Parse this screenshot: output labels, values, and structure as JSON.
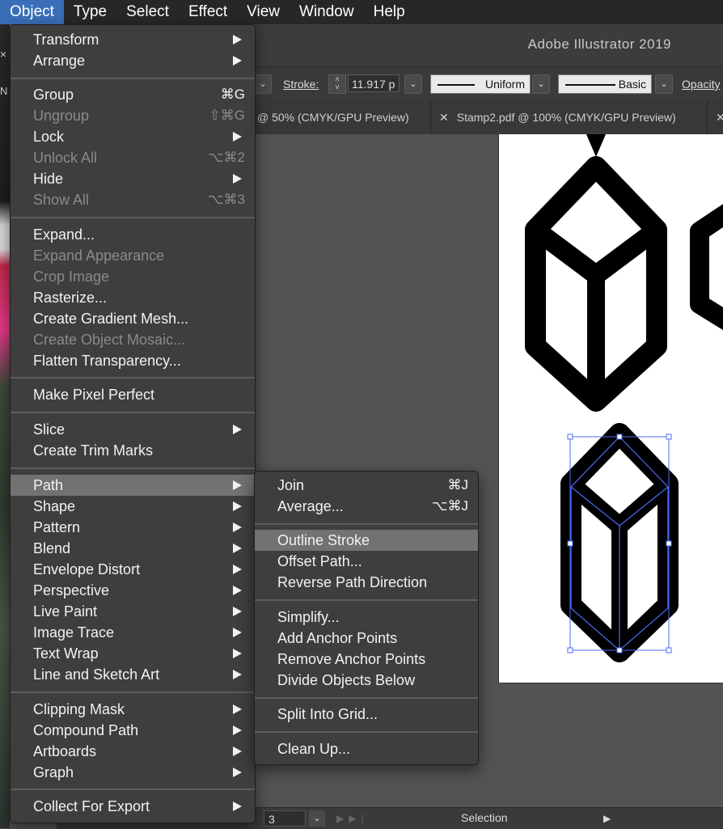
{
  "menubar": {
    "items": [
      "Object",
      "Type",
      "Select",
      "Effect",
      "View",
      "Window",
      "Help"
    ],
    "active": "Object"
  },
  "app": {
    "title": "Adobe Illustrator 2019"
  },
  "control_bar": {
    "stroke_label": "Stroke:",
    "stroke_value": "11.917 p",
    "profile_uniform": "Uniform",
    "brush_basic": "Basic",
    "opacity_label": "Opacity"
  },
  "tabs": [
    {
      "label": "@ 50% (CMYK/GPU Preview)"
    },
    {
      "label": "Stamp2.pdf @ 100% (CMYK/GPU Preview)"
    }
  ],
  "object_menu": {
    "items": [
      {
        "label": "Transform",
        "shortcut": "",
        "submenu": true,
        "disabled": false
      },
      {
        "label": "Arrange",
        "shortcut": "",
        "submenu": true,
        "disabled": false
      },
      {
        "label": "Group",
        "shortcut": "⌘G",
        "submenu": false,
        "disabled": false
      },
      {
        "label": "Ungroup",
        "shortcut": "⇧⌘G",
        "submenu": false,
        "disabled": true
      },
      {
        "label": "Lock",
        "shortcut": "",
        "submenu": true,
        "disabled": false
      },
      {
        "label": "Unlock All",
        "shortcut": "⌥⌘2",
        "submenu": false,
        "disabled": true
      },
      {
        "label": "Hide",
        "shortcut": "",
        "submenu": true,
        "disabled": false
      },
      {
        "label": "Show All",
        "shortcut": "⌥⌘3",
        "submenu": false,
        "disabled": true
      },
      {
        "label": "Expand...",
        "shortcut": "",
        "submenu": false,
        "disabled": false
      },
      {
        "label": "Expand Appearance",
        "shortcut": "",
        "submenu": false,
        "disabled": true
      },
      {
        "label": "Crop Image",
        "shortcut": "",
        "submenu": false,
        "disabled": true
      },
      {
        "label": "Rasterize...",
        "shortcut": "",
        "submenu": false,
        "disabled": false
      },
      {
        "label": "Create Gradient Mesh...",
        "shortcut": "",
        "submenu": false,
        "disabled": false
      },
      {
        "label": "Create Object Mosaic...",
        "shortcut": "",
        "submenu": false,
        "disabled": true
      },
      {
        "label": "Flatten Transparency...",
        "shortcut": "",
        "submenu": false,
        "disabled": false
      },
      {
        "label": "Make Pixel Perfect",
        "shortcut": "",
        "submenu": false,
        "disabled": false
      },
      {
        "label": "Slice",
        "shortcut": "",
        "submenu": true,
        "disabled": false
      },
      {
        "label": "Create Trim Marks",
        "shortcut": "",
        "submenu": false,
        "disabled": false
      },
      {
        "label": "Path",
        "shortcut": "",
        "submenu": true,
        "disabled": false,
        "highlighted": true
      },
      {
        "label": "Shape",
        "shortcut": "",
        "submenu": true,
        "disabled": false
      },
      {
        "label": "Pattern",
        "shortcut": "",
        "submenu": true,
        "disabled": false
      },
      {
        "label": "Blend",
        "shortcut": "",
        "submenu": true,
        "disabled": false
      },
      {
        "label": "Envelope Distort",
        "shortcut": "",
        "submenu": true,
        "disabled": false
      },
      {
        "label": "Perspective",
        "shortcut": "",
        "submenu": true,
        "disabled": false
      },
      {
        "label": "Live Paint",
        "shortcut": "",
        "submenu": true,
        "disabled": false
      },
      {
        "label": "Image Trace",
        "shortcut": "",
        "submenu": true,
        "disabled": false
      },
      {
        "label": "Text Wrap",
        "shortcut": "",
        "submenu": true,
        "disabled": false
      },
      {
        "label": "Line and Sketch Art",
        "shortcut": "",
        "submenu": true,
        "disabled": false
      },
      {
        "label": "Clipping Mask",
        "shortcut": "",
        "submenu": true,
        "disabled": false
      },
      {
        "label": "Compound Path",
        "shortcut": "",
        "submenu": true,
        "disabled": false
      },
      {
        "label": "Artboards",
        "shortcut": "",
        "submenu": true,
        "disabled": false
      },
      {
        "label": "Graph",
        "shortcut": "",
        "submenu": true,
        "disabled": false
      },
      {
        "label": "Collect For Export",
        "shortcut": "",
        "submenu": true,
        "disabled": false
      }
    ]
  },
  "path_menu": {
    "items": [
      {
        "label": "Join",
        "shortcut": "⌘J"
      },
      {
        "label": "Average...",
        "shortcut": "⌥⌘J"
      },
      {
        "label": "Outline Stroke",
        "shortcut": "",
        "highlighted": true
      },
      {
        "label": "Offset Path...",
        "shortcut": ""
      },
      {
        "label": "Reverse Path Direction",
        "shortcut": ""
      },
      {
        "label": "Simplify...",
        "shortcut": ""
      },
      {
        "label": "Add Anchor Points",
        "shortcut": ""
      },
      {
        "label": "Remove Anchor Points",
        "shortcut": ""
      },
      {
        "label": "Divide Objects Below",
        "shortcut": ""
      },
      {
        "label": "Split Into Grid...",
        "shortcut": ""
      },
      {
        "label": "Clean Up...",
        "shortcut": ""
      }
    ]
  },
  "status_bar": {
    "artboard_number": "3",
    "tool": "Selection"
  },
  "colors": {
    "menu_active": "#3a6fb8",
    "menu_highlight": "#727272",
    "selection_blue": "#4a6cf7"
  },
  "icons": [
    "chevron-down-icon",
    "close-icon",
    "submenu-arrow-icon",
    "stepper-icon",
    "play-icon"
  ]
}
